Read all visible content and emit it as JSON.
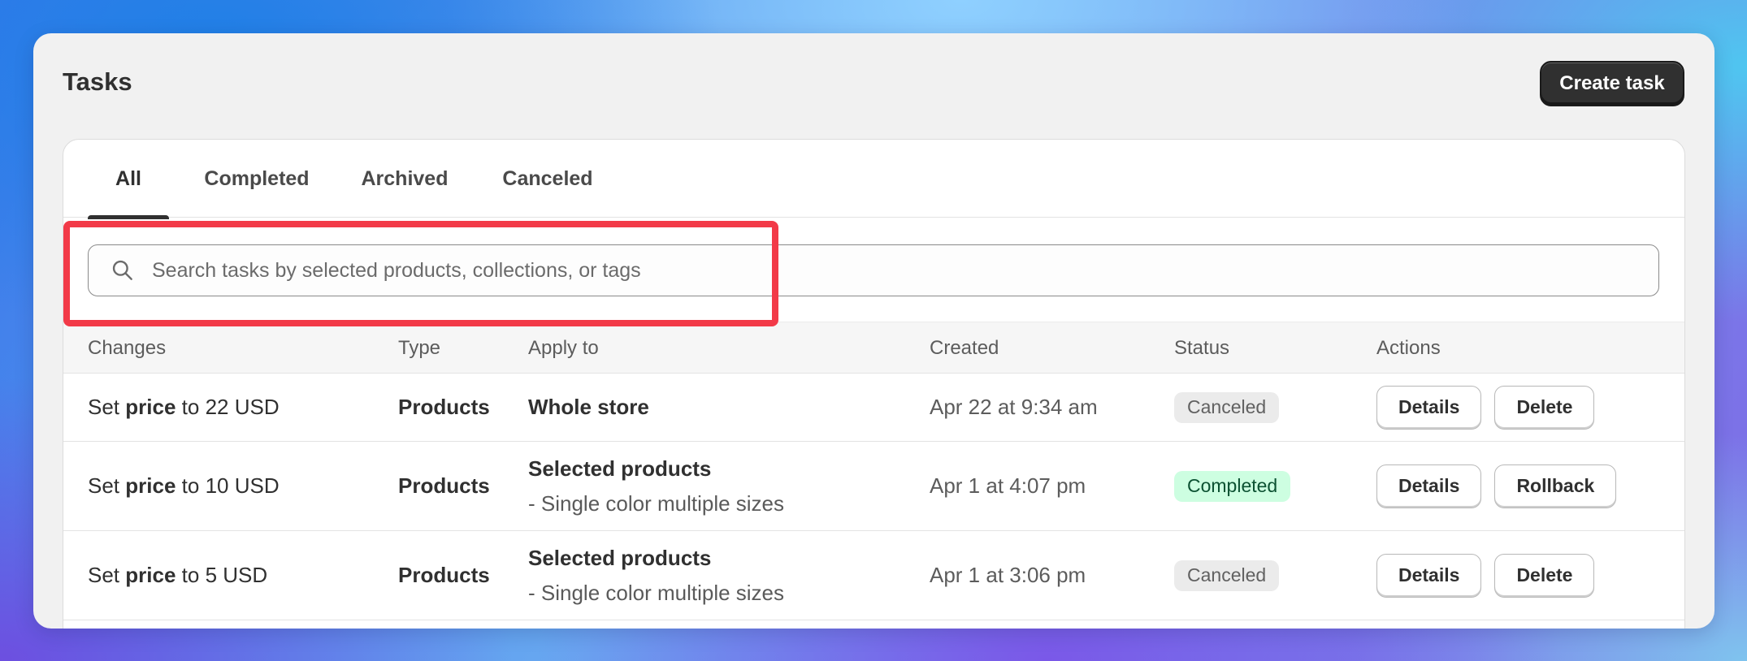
{
  "header": {
    "title": "Tasks",
    "create_label": "Create task"
  },
  "tabs": [
    {
      "label": "All",
      "active": true
    },
    {
      "label": "Completed",
      "active": false
    },
    {
      "label": "Archived",
      "active": false
    },
    {
      "label": "Canceled",
      "active": false
    }
  ],
  "search": {
    "placeholder": "Search tasks by selected products, collections, or tags",
    "value": ""
  },
  "table": {
    "columns": [
      "Changes",
      "Type",
      "Apply to",
      "Created",
      "Status",
      "Actions"
    ],
    "rows": [
      {
        "change_prefix": "Set",
        "change_field": "price",
        "change_suffix": "to 22 USD",
        "type": "Products",
        "apply_title": "Whole store",
        "apply_sub": "",
        "created": "Apr 22 at 9:34 am",
        "status": "Canceled",
        "actions": [
          "Details",
          "Delete"
        ]
      },
      {
        "change_prefix": "Set",
        "change_field": "price",
        "change_suffix": "to 10 USD",
        "type": "Products",
        "apply_title": "Selected products",
        "apply_sub": "- Single color multiple sizes",
        "created": "Apr 1 at 4:07 pm",
        "status": "Completed",
        "actions": [
          "Details",
          "Rollback"
        ]
      },
      {
        "change_prefix": "Set",
        "change_field": "price",
        "change_suffix": "to 5 USD",
        "type": "Products",
        "apply_title": "Selected products",
        "apply_sub": "- Single color multiple sizes",
        "created": "Apr 1 at 3:06 pm",
        "status": "Canceled",
        "actions": [
          "Details",
          "Delete"
        ]
      }
    ]
  },
  "colors": {
    "highlight": "#f23a48",
    "completed_badge_bg": "#cdfee1",
    "canceled_badge_bg": "#ebebeb",
    "primary_button": "#303030"
  },
  "icons": {
    "search": "search-icon"
  }
}
